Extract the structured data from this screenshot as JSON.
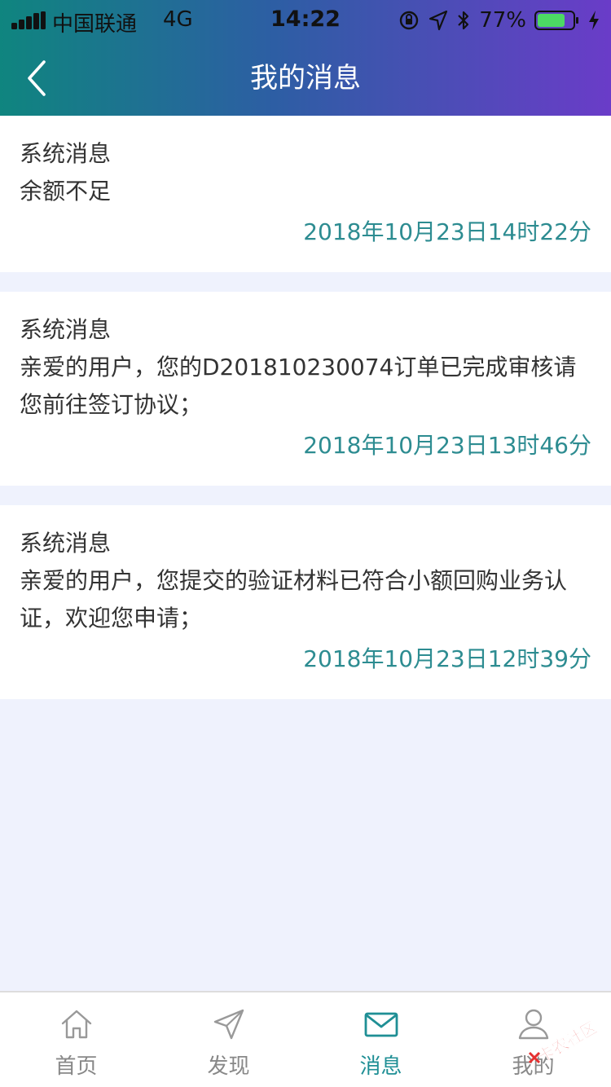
{
  "status_bar": {
    "carrier": "中国联通",
    "network": "4G",
    "time": "14:22",
    "battery_percent": "77%"
  },
  "nav": {
    "title": "我的消息",
    "back_icon": "chevron-left-icon"
  },
  "messages": [
    {
      "title": "系统消息",
      "content": "余额不足",
      "time": "2018年10月23日14时22分"
    },
    {
      "title": "系统消息",
      "content": "亲爱的用户，您的D201810230074订单已完成审核请您前往签订协议；",
      "time": "2018年10月23日13时46分"
    },
    {
      "title": "系统消息",
      "content": "亲爱的用户，您提交的验证材料已符合小额回购业务认证，欢迎您申请；",
      "time": "2018年10月23日12时39分"
    }
  ],
  "tabbar": {
    "tabs": [
      {
        "label": "首页",
        "icon": "home-icon",
        "active": false
      },
      {
        "label": "发现",
        "icon": "paper-plane-icon",
        "active": false
      },
      {
        "label": "消息",
        "icon": "mail-icon",
        "active": true
      },
      {
        "label": "我的",
        "icon": "user-icon",
        "active": false
      }
    ]
  },
  "watermark": {
    "text": "卡农社区"
  },
  "colors": {
    "header_gradient_start": "#0f857f",
    "header_gradient_end": "#6a3cc8",
    "accent": "#1f8f95",
    "time_text": "#2d8c91",
    "background": "#eff2fd",
    "tab_inactive": "#888888",
    "battery_green": "#4cd964"
  }
}
